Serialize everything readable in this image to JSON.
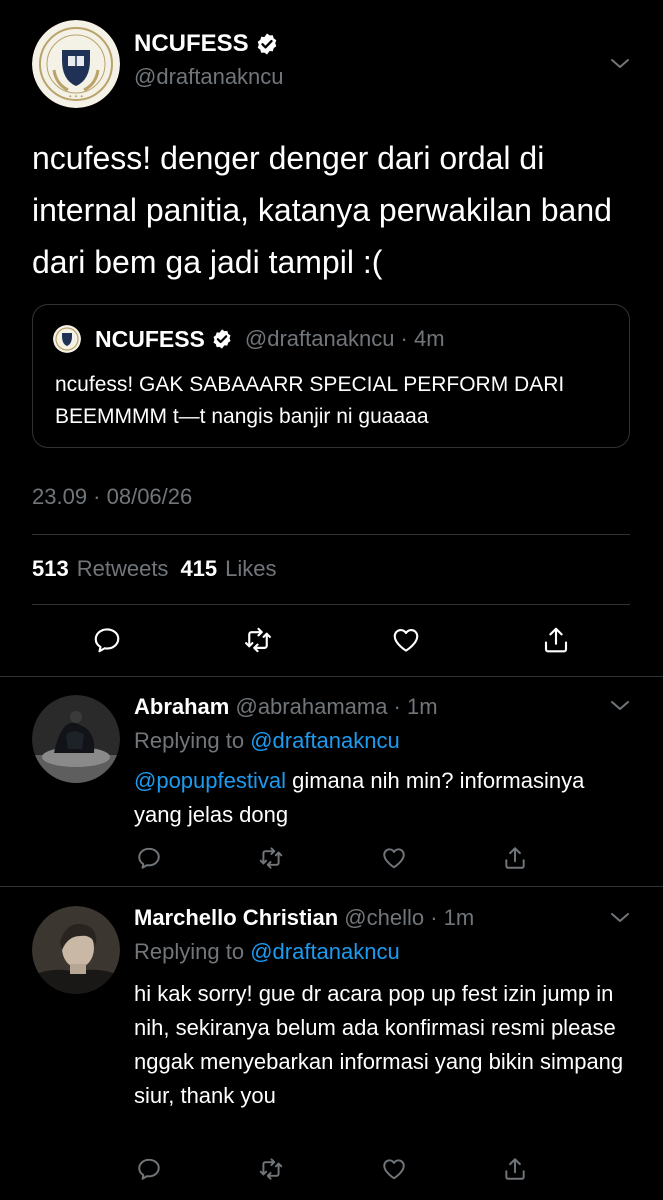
{
  "tweet": {
    "name": "NCUFESS",
    "handle": "@draftanakncu",
    "text": "ncufess! denger denger dari ordal di internal panitia, katanya perwakilan band dari bem ga jadi tampil :(",
    "timestamp": "23.09 · 08/06/26",
    "retweets_count": "513",
    "retweets_label": "Retweets",
    "likes_count": "415",
    "likes_label": "Likes",
    "logo_text": "NEW CITY UNIVERSITY"
  },
  "quote": {
    "name": "NCUFESS",
    "meta": "@draftanakncu · 4m",
    "text": "ncufess! GAK SABAAARR SPECIAL PERFORM DARI BEEMMMM t—t nangis banjir ni guaaaa"
  },
  "replies": [
    {
      "name": "Abraham",
      "meta": "@abrahamama · 1m",
      "replying_label": "Replying to",
      "replying_to": "@draftanakncu",
      "mention": "@popupfestival",
      "text": " gimana nih min? informasinya yang jelas dong"
    },
    {
      "name": "Marchello Christian",
      "meta": "@chello · 1m",
      "replying_label": "Replying to",
      "replying_to": "@draftanakncu",
      "text": "hi kak sorry! gue dr acara pop up fest izin jump in nih, sekiranya belum ada konfirmasi resmi please nggak menyebarkan informasi yang bikin simpang siur, thank you"
    }
  ],
  "icons": {
    "reply": "reply-icon",
    "retweet": "retweet-icon",
    "like": "heart-icon",
    "share": "share-icon",
    "more": "chevron-down-icon",
    "verified": "verified-badge-icon"
  },
  "colors": {
    "background": "#000000",
    "text": "#ffffff",
    "muted": "#71767b",
    "link": "#1d9bf0",
    "divider": "#2f3336"
  }
}
